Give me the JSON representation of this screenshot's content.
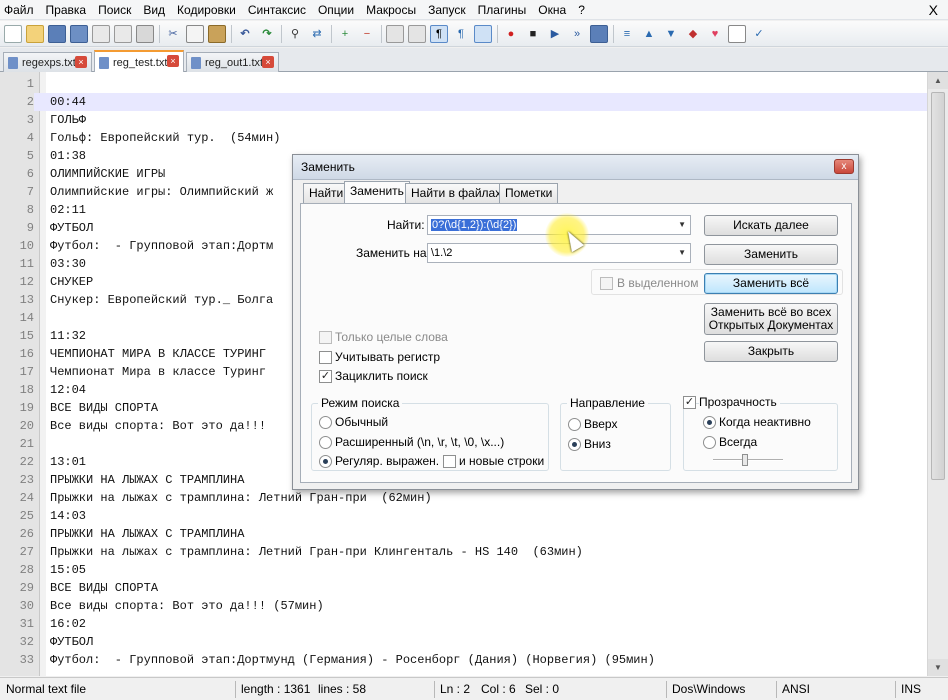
{
  "menubar": {
    "items": [
      "Файл",
      "Правка",
      "Поиск",
      "Вид",
      "Кодировки",
      "Синтаксис",
      "Опции",
      "Макросы",
      "Запуск",
      "Плагины",
      "Окна",
      "?"
    ],
    "close": "X"
  },
  "toolbar": {
    "icons": [
      "new-file-icon",
      "open-file-icon",
      "save-icon",
      "save-all-icon",
      "close-file-icon",
      "close-all-icon",
      "print-icon",
      "cut-icon",
      "copy-icon",
      "paste-icon",
      "undo-icon",
      "redo-icon",
      "find-icon",
      "replace-icon",
      "zoom-in-icon",
      "zoom-out-icon",
      "sync-scroll-icon",
      "word-wrap-icon",
      "show-all-chars-icon",
      "indent-guide-icon",
      "doc-map-icon",
      "record-macro-icon",
      "stop-record-icon",
      "play-macro-icon",
      "run-macro-multiple-icon",
      "save-macro-icon",
      "nav-left-icon",
      "nav-up-icon",
      "nav-down-icon",
      "bookmark-icon",
      "heart-icon",
      "launch-icon",
      "spellcheck-icon"
    ]
  },
  "tabs": [
    {
      "label": "regexps.txt",
      "active": false
    },
    {
      "label": "reg_test.txt",
      "active": true
    },
    {
      "label": "reg_out1.txt",
      "active": false
    }
  ],
  "editor": {
    "lines": [
      {
        "n": "1",
        "t": ""
      },
      {
        "n": "2",
        "t": "00:44"
      },
      {
        "n": "3",
        "t": "ГОЛЬФ"
      },
      {
        "n": "4",
        "t": "Гольф: Европейский тур.  (54мин)"
      },
      {
        "n": "5",
        "t": "01:38"
      },
      {
        "n": "6",
        "t": "ОЛИМПИЙСКИЕ ИГРЫ"
      },
      {
        "n": "7",
        "t": "Олимпийские игры: Олимпийский ж"
      },
      {
        "n": "8",
        "t": "02:11"
      },
      {
        "n": "9",
        "t": "ФУТБОЛ"
      },
      {
        "n": "10",
        "t": "Футбол:  - Групповой этап:Дортм"
      },
      {
        "n": "11",
        "t": "03:30"
      },
      {
        "n": "12",
        "t": "СНУКЕР"
      },
      {
        "n": "13",
        "t": "Снукер: Европейский тур._ Болга"
      },
      {
        "n": "14",
        "t": ""
      },
      {
        "n": "15",
        "t": "11:32"
      },
      {
        "n": "16",
        "t": "ЧЕМПИОНАТ МИРА В КЛАССЕ ТУРИНГ"
      },
      {
        "n": "17",
        "t": "Чемпионат Мира в классе Туринг"
      },
      {
        "n": "18",
        "t": "12:04"
      },
      {
        "n": "19",
        "t": "ВСЕ ВИДЫ СПОРТА"
      },
      {
        "n": "20",
        "t": "Все виды спорта: Вот это да!!!"
      },
      {
        "n": "21",
        "t": ""
      },
      {
        "n": "22",
        "t": "13:01"
      },
      {
        "n": "23",
        "t": "ПРЫЖКИ НА ЛЫЖАХ С ТРАМПЛИНА"
      },
      {
        "n": "24",
        "t": "Прыжки на лыжах с трамплина: Летний Гран-при  (62мин)"
      },
      {
        "n": "25",
        "t": "14:03"
      },
      {
        "n": "26",
        "t": "ПРЫЖКИ НА ЛЫЖАХ С ТРАМПЛИНА"
      },
      {
        "n": "27",
        "t": "Прыжки на лыжах с трамплина: Летний Гран-при Клингенталь - HS 140  (63мин)"
      },
      {
        "n": "28",
        "t": "15:05"
      },
      {
        "n": "29",
        "t": "ВСЕ ВИДЫ СПОРТА"
      },
      {
        "n": "30",
        "t": "Все виды спорта: Вот это да!!! (57мин)"
      },
      {
        "n": "31",
        "t": "16:02"
      },
      {
        "n": "32",
        "t": "ФУТБОЛ"
      },
      {
        "n": "33",
        "t": "Футбол:  - Групповой этап:Дортмунд (Германия) - Росенборг (Дания) (Норвегия) (95мин)"
      }
    ]
  },
  "statusbar": {
    "type": "Normal text file",
    "length": "length : 1361",
    "lines": "lines : 58",
    "ln": "Ln : 2",
    "col": "Col : 6",
    "sel": "Sel : 0",
    "eol": "Dos\\Windows",
    "encoding": "ANSI",
    "mode": "INS"
  },
  "dialog": {
    "title": "Заменить",
    "close": "x",
    "tabs": [
      "Найти",
      "Заменить",
      "Найти в файлах",
      "Пометки"
    ],
    "find_label": "Найти:",
    "find_value": "0?(\\d{1,2}):(\\d{2})",
    "replace_label": "Заменить на:",
    "replace_value": "\\1.\\2",
    "in_selection": "В выделенном",
    "buttons": {
      "find_next": "Искать далее",
      "replace": "Заменить",
      "replace_all": "Заменить всё",
      "replace_all_docs_1": "Заменить всё во всех",
      "replace_all_docs_2": "Открытых Документах",
      "close": "Закрыть"
    },
    "options": {
      "whole_word": "Только целые слова",
      "match_case": "Учитывать регистр",
      "wrap": "Зациклить поиск"
    },
    "search_mode": {
      "title": "Режим поиска",
      "normal": "Обычный",
      "extended": "Расширенный (\\n, \\r, \\t, \\0, \\x...)",
      "regex": "Регуляр. выражен.",
      "newlines": "и новые строки"
    },
    "direction": {
      "title": "Направление",
      "up": "Вверх",
      "down": "Вниз"
    },
    "transparency": {
      "title": "Прозрачность",
      "on_lose_focus": "Когда неактивно",
      "always": "Всегда",
      "level": 0.45
    }
  }
}
